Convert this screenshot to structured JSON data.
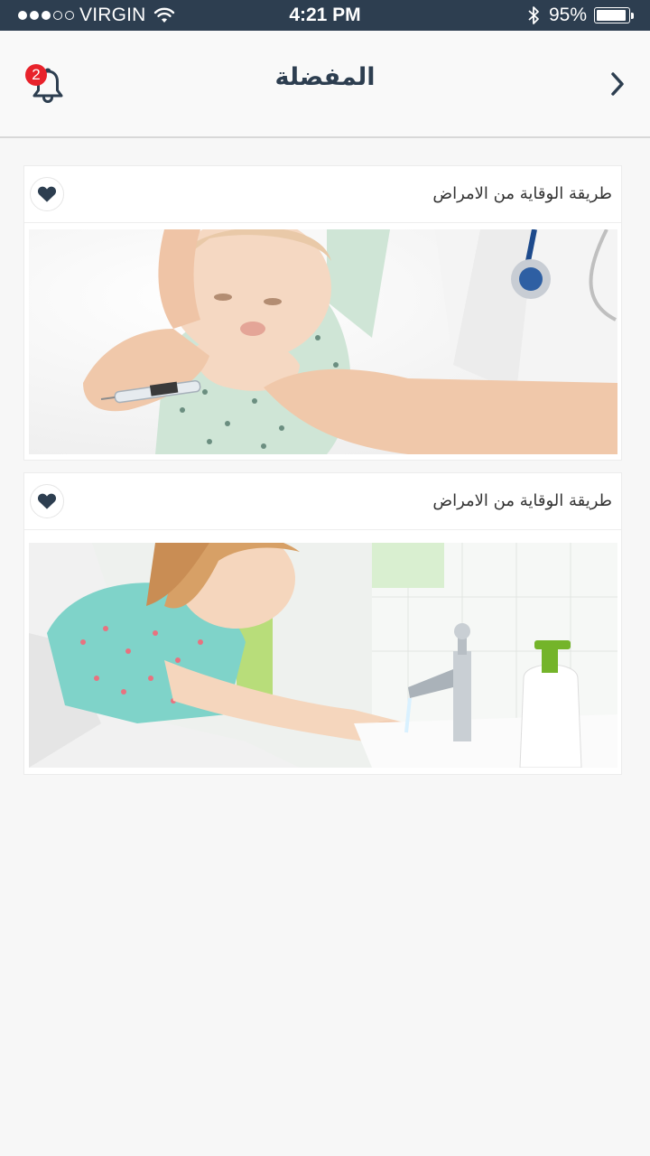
{
  "status_bar": {
    "carrier": "VIRGIN",
    "time": "4:21 PM",
    "battery": "95%",
    "battery_level": 0.95,
    "signal_bars": 3,
    "signal_total": 5
  },
  "header": {
    "title": "المفضلة",
    "notification_count": "2",
    "icons": {
      "left": "bell-icon",
      "right": "chevron-right-icon"
    }
  },
  "cards": [
    {
      "title": "طريقة الوقاية من الامراض",
      "image": "baby-vaccination-photo",
      "favorited": true
    },
    {
      "title": "طريقة الوقاية من الامراض",
      "image": "child-handwashing-photo",
      "favorited": true
    }
  ],
  "colors": {
    "status_bar": "#2d3e50",
    "title": "#2d3e50",
    "badge": "#e8222b",
    "heart": "#2d3e50",
    "background": "#f7f7f7"
  }
}
